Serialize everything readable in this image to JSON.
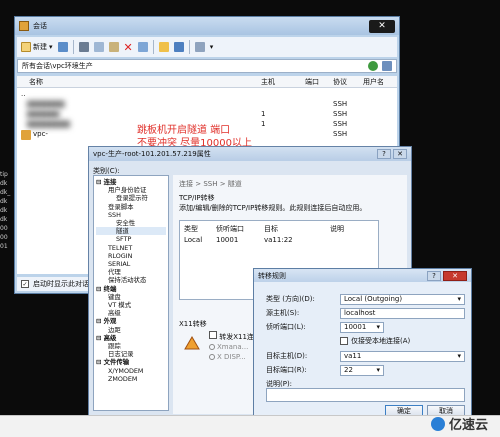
{
  "desktop": {
    "side_labels": [
      "tip",
      "dk",
      "dk_",
      "dk",
      "dk",
      "dk",
      "00",
      "00",
      "01"
    ],
    "watermark": "亿速云"
  },
  "session_manager": {
    "title": "会话",
    "toolbar": {
      "new_label": "新建"
    },
    "address": "所有会话\\vpc环境生产",
    "columns": {
      "name": "名称",
      "host": "主机",
      "port": "端口",
      "protocol": "协议",
      "username": "用户名"
    },
    "rows": [
      {
        "name": "..",
        "host": "",
        "port": "",
        "protocol": "",
        "username": ""
      },
      {
        "name": "",
        "host": "",
        "port": "",
        "protocol": "SSH",
        "username": ""
      },
      {
        "name": "",
        "host": "1",
        "port": "",
        "protocol": "SSH",
        "username": ""
      },
      {
        "name": "",
        "host": "1",
        "port": "",
        "protocol": "SSH",
        "username": ""
      },
      {
        "name": "vpc-",
        "host": "",
        "port": "",
        "protocol": "SSH",
        "username": ""
      }
    ],
    "annotation": {
      "line1": "跳板机开启隧道 端口",
      "line2": "不要冲突 尽量10000以上"
    },
    "status_checkbox_label": "启动时显示此对话框"
  },
  "properties": {
    "title": "vpc-生产-root-101.201.57.219属性",
    "category_label": "类别(C):",
    "tree": [
      {
        "label": "连接",
        "level": 0
      },
      {
        "label": "用户身份验证",
        "level": 1
      },
      {
        "label": "登录提示符",
        "level": 2
      },
      {
        "label": "登录脚本",
        "level": 1
      },
      {
        "label": "SSH",
        "level": 1
      },
      {
        "label": "安全性",
        "level": 2
      },
      {
        "label": "隧道",
        "level": 2
      },
      {
        "label": "SFTP",
        "level": 2
      },
      {
        "label": "TELNET",
        "level": 1
      },
      {
        "label": "RLOGIN",
        "level": 1
      },
      {
        "label": "SERIAL",
        "level": 1
      },
      {
        "label": "代理",
        "level": 1
      },
      {
        "label": "保持活动状态",
        "level": 1
      },
      {
        "label": "终端",
        "level": 0
      },
      {
        "label": "键盘",
        "level": 1
      },
      {
        "label": "VT 模式",
        "level": 1
      },
      {
        "label": "高级",
        "level": 1
      },
      {
        "label": "外观",
        "level": 0
      },
      {
        "label": "边距",
        "level": 1
      },
      {
        "label": "高级",
        "level": 0
      },
      {
        "label": "跟踪",
        "level": 1
      },
      {
        "label": "日志记录",
        "level": 1
      },
      {
        "label": "文件传输",
        "level": 0
      },
      {
        "label": "X/YMODEM",
        "level": 1
      },
      {
        "label": "ZMODEM",
        "level": 1
      }
    ],
    "breadcrumb": "连接 > SSH > 隧道",
    "section_title": "TCP/IP转移",
    "section_desc": "添加/编辑/删除的TCP/IP转移规则。此规则连接后自动应用。",
    "table_headers": {
      "type": "类型",
      "listen_port": "侦听端口",
      "target": "目标",
      "desc": "说明"
    },
    "table_row": {
      "type": "Local",
      "listen_port": "10001",
      "target": "va11:22",
      "desc": ""
    },
    "x11_title": "X11转移",
    "x11_option": "转发X11连接",
    "x11_radio1": "Xmana...",
    "x11_radio2": "X DISP..."
  },
  "rule_dialog": {
    "title": "转移规则",
    "type_label": "类型 (方向)(D):",
    "type_value": "Local (Outgoing)",
    "source_host_label": "源主机(S):",
    "source_host_value": "localhost",
    "listen_port_label": "侦听端口(L):",
    "listen_port_value": "10001",
    "local_only_label": "仅接受本地连接(A)",
    "target_host_label": "目标主机(D):",
    "target_host_value": "va11",
    "target_port_label": "目标端口(R):",
    "target_port_value": "22",
    "note_label": "说明(P):",
    "ok_label": "确定",
    "cancel_label": "取消"
  }
}
